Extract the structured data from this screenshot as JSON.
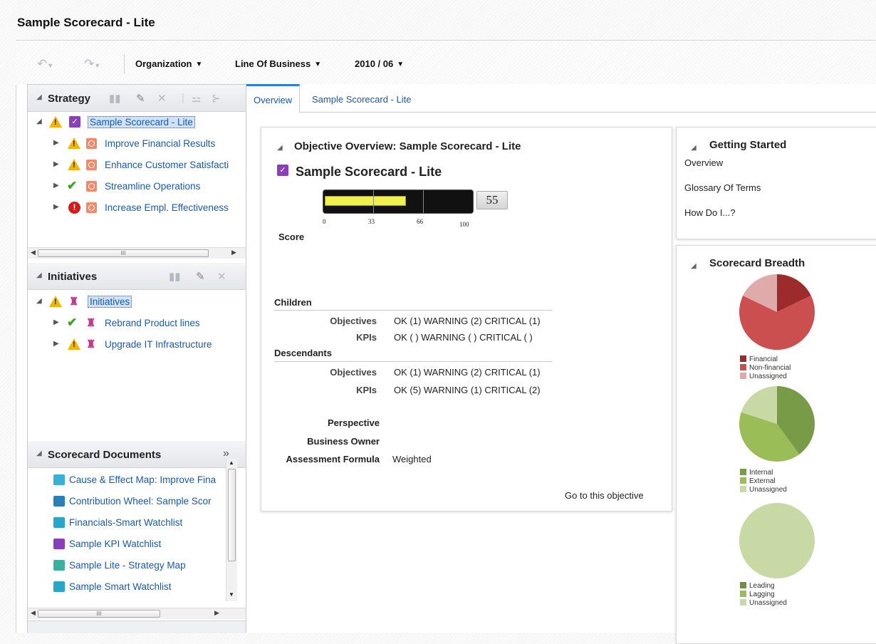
{
  "page": {
    "title": "Sample Scorecard - Lite"
  },
  "toolbar": {
    "organization": "Organization",
    "line_of_business": "Line Of Business",
    "period": "2010 / 06"
  },
  "strategy_pane": {
    "title": "Strategy",
    "root": {
      "label": "Sample Scorecard - Lite",
      "status": "warning"
    },
    "items": [
      {
        "label": "Improve Financial Results",
        "status": "warning"
      },
      {
        "label": "Enhance Customer Satisfacti",
        "status": "warning"
      },
      {
        "label": "Streamline Operations",
        "status": "ok"
      },
      {
        "label": "Increase Empl. Effectiveness",
        "status": "critical"
      }
    ]
  },
  "initiatives_pane": {
    "title": "Initiatives",
    "root": {
      "label": "Initiatives",
      "status": "warning"
    },
    "items": [
      {
        "label": "Rebrand Product lines",
        "status": "ok"
      },
      {
        "label": "Upgrade IT Infrastructure",
        "status": "warning"
      }
    ]
  },
  "documents_pane": {
    "title": "Scorecard Documents",
    "items": [
      {
        "label": "Cause & Effect Map: Improve Fina",
        "icon": "cause-effect-icon",
        "color": "#3ab0d8"
      },
      {
        "label": "Contribution Wheel: Sample Scor",
        "icon": "contribution-wheel-icon",
        "color": "#2a7fb8"
      },
      {
        "label": "Financials-Smart Watchlist",
        "icon": "smart-watchlist-icon",
        "color": "#28a6c8"
      },
      {
        "label": "Sample KPI Watchlist",
        "icon": "kpi-watchlist-icon",
        "color": "#8a3fb8"
      },
      {
        "label": "Sample Lite - Strategy Map",
        "icon": "strategy-map-icon",
        "color": "#3ab0a0"
      },
      {
        "label": "Sample Smart Watchlist",
        "icon": "smart-watchlist-icon",
        "color": "#28a6c8"
      }
    ]
  },
  "tabs": [
    {
      "label": "Overview",
      "active": true
    },
    {
      "label": "Sample Scorecard - Lite",
      "active": false
    }
  ],
  "objective_overview": {
    "title": "Objective Overview: Sample Scorecard - Lite",
    "name": "Sample Scorecard - Lite",
    "score_label": "Score",
    "score_value": "55",
    "gauge_ticks": [
      "0",
      "33",
      "66",
      "100"
    ],
    "gauge_fill_fraction": 0.55,
    "children_heading": "Children",
    "descendants_heading": "Descendants",
    "children": {
      "objectives_label": "Objectives",
      "objectives_value": "OK (1)  WARNING (2)  CRITICAL (1)",
      "kpis_label": "KPIs",
      "kpis_value": "OK ( )  WARNING ( )  CRITICAL ( )"
    },
    "descendants": {
      "objectives_label": "Objectives",
      "objectives_value": "OK (1)  WARNING (2)  CRITICAL (1)",
      "kpis_label": "KPIs",
      "kpis_value": "OK (5)  WARNING (1)  CRITICAL (2)"
    },
    "perspective_label": "Perspective",
    "business_owner_label": "Business Owner",
    "assessment_formula_label": "Assessment Formula",
    "assessment_formula_value": "Weighted",
    "go_link": "Go to this objective"
  },
  "getting_started": {
    "title": "Getting Started",
    "links": [
      "Overview",
      "Glossary Of Terms",
      "How Do I...?"
    ]
  },
  "scorecard_breadth": {
    "title": "Scorecard Breadth",
    "pies": [
      {
        "slices": [
          {
            "label": "Financial",
            "value": 1,
            "color": "#9e2b2b"
          },
          {
            "label": "Non-financial",
            "value": 3.6,
            "color": "#cc4f4f"
          },
          {
            "label": "Unassigned",
            "value": 1,
            "color": "#deaaaa"
          }
        ]
      },
      {
        "slices": [
          {
            "label": "Internal",
            "value": 2,
            "color": "#789b48"
          },
          {
            "label": "External",
            "value": 2,
            "color": "#9bbd58"
          },
          {
            "label": "Unassigned",
            "value": 1,
            "color": "#c8d9a6"
          }
        ]
      },
      {
        "slices": [
          {
            "label": "Leading",
            "value": 0,
            "color": "#6d8f3e"
          },
          {
            "label": "Lagging",
            "value": 0,
            "color": "#9bbd58"
          },
          {
            "label": "Unassigned",
            "value": 1,
            "color": "#c8d9a6"
          }
        ]
      }
    ]
  }
}
